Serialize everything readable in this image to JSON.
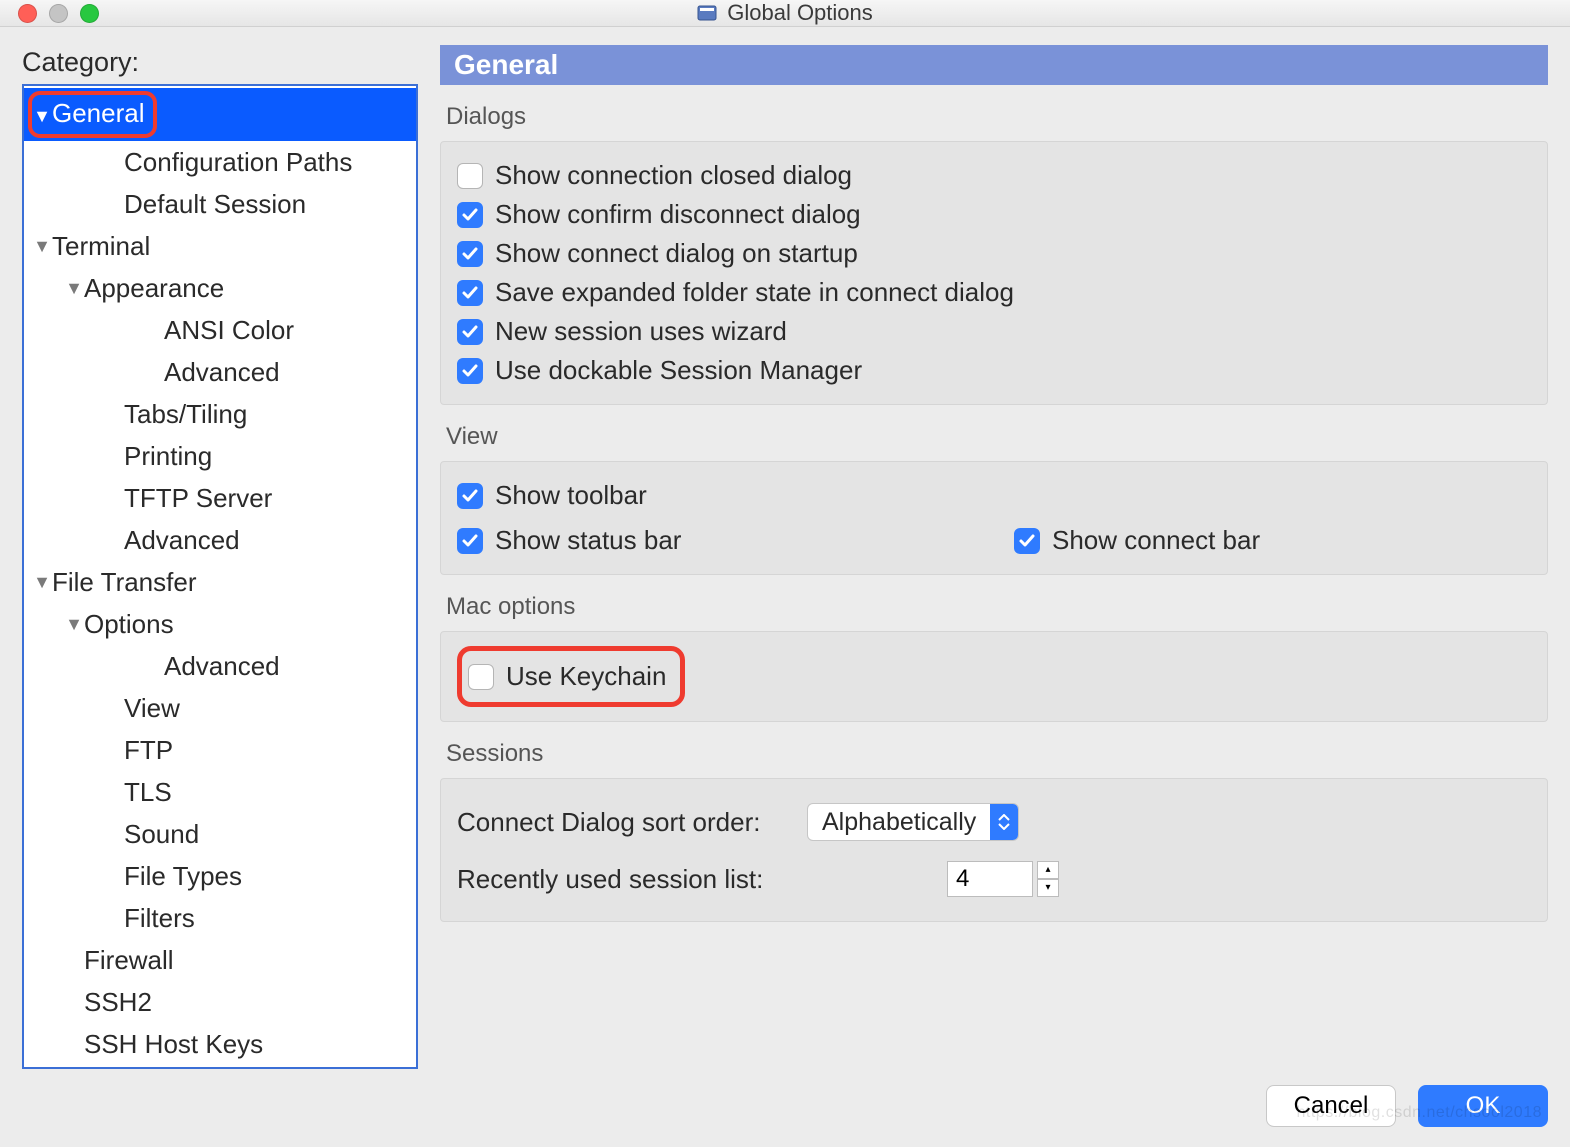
{
  "window": {
    "title": "Global Options"
  },
  "sidebar": {
    "label": "Category:",
    "items": [
      {
        "label": "General",
        "level": 0,
        "chev": "open",
        "selected": true,
        "highlight": true
      },
      {
        "label": "Configuration Paths",
        "level": 2
      },
      {
        "label": "Default Session",
        "level": 2
      },
      {
        "label": "Terminal",
        "level": 0,
        "chev": "open-grey"
      },
      {
        "label": "Appearance",
        "level": 1,
        "chev": "open-grey"
      },
      {
        "label": "ANSI Color",
        "level": 3
      },
      {
        "label": "Advanced",
        "level": 3
      },
      {
        "label": "Tabs/Tiling",
        "level": 2
      },
      {
        "label": "Printing",
        "level": 2
      },
      {
        "label": "TFTP Server",
        "level": 2
      },
      {
        "label": "Advanced",
        "level": 2
      },
      {
        "label": "File Transfer",
        "level": 0,
        "chev": "open-grey"
      },
      {
        "label": "Options",
        "level": 1,
        "chev": "open-grey"
      },
      {
        "label": "Advanced",
        "level": 3
      },
      {
        "label": "View",
        "level": 2
      },
      {
        "label": "FTP",
        "level": 2
      },
      {
        "label": "TLS",
        "level": 2
      },
      {
        "label": "Sound",
        "level": 2
      },
      {
        "label": "File Types",
        "level": 2
      },
      {
        "label": "Filters",
        "level": 2
      },
      {
        "label": "Firewall",
        "level": 1
      },
      {
        "label": "SSH2",
        "level": 1
      },
      {
        "label": "SSH Host Keys",
        "level": 1
      }
    ]
  },
  "panel": {
    "title": "General",
    "groups": {
      "dialogs": {
        "title": "Dialogs",
        "items": [
          {
            "label": "Show connection closed dialog",
            "checked": false
          },
          {
            "label": "Show confirm disconnect dialog",
            "checked": true
          },
          {
            "label": "Show connect dialog on startup",
            "checked": true
          },
          {
            "label": "Save expanded folder state in connect dialog",
            "checked": true
          },
          {
            "label": "New session uses wizard",
            "checked": true
          },
          {
            "label": "Use dockable Session Manager",
            "checked": true
          }
        ]
      },
      "view": {
        "title": "View",
        "items": [
          {
            "label": "Show toolbar",
            "checked": true
          },
          {
            "label": "Show status bar",
            "checked": true
          },
          {
            "label": "Show connect bar",
            "checked": true
          }
        ]
      },
      "mac": {
        "title": "Mac options",
        "items": [
          {
            "label": "Use Keychain",
            "checked": false,
            "highlight": true
          }
        ]
      },
      "sessions": {
        "title": "Sessions",
        "sortLabel": "Connect Dialog sort order:",
        "sortValue": "Alphabetically",
        "recentLabel": "Recently used session list:",
        "recentValue": "4"
      }
    }
  },
  "footer": {
    "cancel": "Cancel",
    "ok": "OK"
  },
  "watermark": "https://blog.csdn.net/chsool2018"
}
